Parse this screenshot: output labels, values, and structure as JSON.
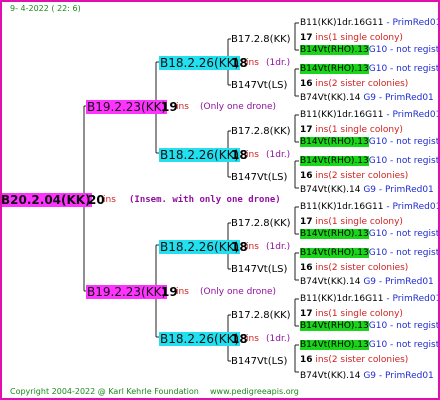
{
  "header": {
    "date": "9-   4-2022 (  22:   6)"
  },
  "footer": {
    "copyright": "Copyright 2004-2022 @ Karl Kehrle Foundation",
    "website": "www.pedigreeapis.org"
  },
  "root": {
    "code": "B20.2.04(KK)",
    "num": "20",
    "tag": "ins",
    "desc": "(Insem. with only one drone)"
  },
  "gen1": [
    {
      "code": "B19.2.23(KK)",
      "num": "19",
      "tag": "ins",
      "desc": "(Only one drone)"
    },
    {
      "code": "B19.2.23(KK)",
      "num": "19",
      "tag": "ins",
      "desc": "(Only one drone)"
    }
  ],
  "gen2": [
    {
      "code": "B18.2.26(KK)",
      "num": "18",
      "tag": "ins",
      "desc": "(1dr.)"
    },
    {
      "code": "B18.2.26(KK)",
      "num": "18",
      "tag": "ins",
      "desc": "(1dr.)"
    },
    {
      "code": "B18.2.26(KK)",
      "num": "18",
      "tag": "ins",
      "desc": "(1dr.)"
    },
    {
      "code": "B18.2.26(KK)",
      "num": "18",
      "tag": "ins",
      "desc": "(1dr.)"
    }
  ],
  "gen3": {
    "upper": "B17.2.8(KK)",
    "lower": "B147Vt(LS)"
  },
  "gen4": {
    "a": {
      "code": "B11(KK)1dr.16G11",
      "extra": "PrimRed01"
    },
    "b_num": "17",
    "b_tag": "ins",
    "b_desc": "(1 single colony)",
    "c": {
      "code": "B14Vt(RHO).13",
      "extra": "G10 - not registe"
    },
    "d": {
      "code": "B14Vt(RHO).13",
      "extra": "G10 - not registe"
    },
    "e_num": "16",
    "e_tag": "ins",
    "e_desc": "(2 sister colonies)",
    "f": {
      "code": "B74Vt(KK).14",
      "extra": "G9 - PrimRed01"
    },
    "dash": "-"
  }
}
